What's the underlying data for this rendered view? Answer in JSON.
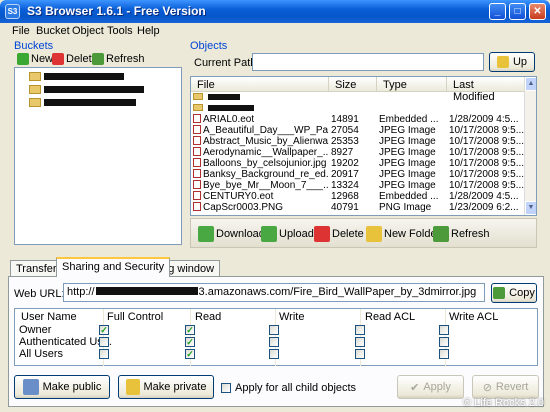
{
  "window": {
    "title": "S3 Browser 1.6.1 - Free Version",
    "app_icon_text": "S3"
  },
  "menu": [
    "File",
    "Bucket",
    "Object",
    "Tools",
    "Help"
  ],
  "buckets": {
    "label": "Buckets",
    "toolbar": {
      "new": "New",
      "delete": "Delete",
      "refresh": "Refresh"
    }
  },
  "objects": {
    "label": "Objects",
    "current_path_label": "Current Path:",
    "current_path_value": "",
    "up_label": "Up",
    "columns": [
      "File",
      "Size",
      "Type",
      "Last Modified"
    ],
    "rows": [
      {
        "name": "",
        "size": "",
        "type": "",
        "modified": "",
        "kind": "folder"
      },
      {
        "name": "",
        "size": "",
        "type": "",
        "modified": "",
        "kind": "folder"
      },
      {
        "name": "ARIAL0.eot",
        "size": "14891",
        "type": "Embedded ...",
        "modified": "1/28/2009 4:5...",
        "kind": "file"
      },
      {
        "name": "A_Beautiful_Day___WP_Pa...",
        "size": "27054",
        "type": "JPEG Image",
        "modified": "10/17/2008 9:5...",
        "kind": "file"
      },
      {
        "name": "Abstract_Music_by_Alienwa...",
        "size": "25353",
        "type": "JPEG Image",
        "modified": "10/17/2008 9:5...",
        "kind": "file"
      },
      {
        "name": "Aerodynamic__Wallpaper_...",
        "size": "8927",
        "type": "JPEG Image",
        "modified": "10/17/2008 9:5...",
        "kind": "file"
      },
      {
        "name": "Balloons_by_celsojunior.jpg",
        "size": "19202",
        "type": "JPEG Image",
        "modified": "10/17/2008 9:5...",
        "kind": "file"
      },
      {
        "name": "Banksy_Background_re_ed...",
        "size": "20917",
        "type": "JPEG Image",
        "modified": "10/17/2008 9:5...",
        "kind": "file"
      },
      {
        "name": "Bye_bye_Mr__Moon_7___...",
        "size": "13324",
        "type": "JPEG Image",
        "modified": "10/17/2008 9:5...",
        "kind": "file"
      },
      {
        "name": "CENTURY0.eot",
        "size": "12968",
        "type": "Embedded ...",
        "modified": "1/28/2009 4:5...",
        "kind": "file"
      },
      {
        "name": "CapScr0003.PNG",
        "size": "40791",
        "type": "PNG Image",
        "modified": "1/23/2009 6:2...",
        "kind": "file"
      }
    ],
    "toolbar": {
      "download": "Download",
      "upload": "Upload",
      "delete": "Delete",
      "new_folder": "New Folder",
      "refresh": "Refresh"
    }
  },
  "tabs": [
    "Transfers",
    "Sharing and Security",
    "Log window"
  ],
  "sharing": {
    "web_url_label": "Web URL:",
    "web_url_prefix": "http://",
    "web_url_suffix": "3.amazonaws.com/Fire_Bird_WallPaper_by_3dmirror.jpg",
    "copy_label": "Copy",
    "perm_columns": [
      "User Name",
      "Full Control",
      "Read",
      "Write",
      "Read ACL",
      "Write ACL"
    ],
    "perm_rows": [
      {
        "user": "Owner",
        "checks": [
          true,
          true,
          false,
          false,
          false
        ]
      },
      {
        "user": "Authenticated Us...",
        "checks": [
          false,
          true,
          false,
          false,
          false
        ]
      },
      {
        "user": "All Users",
        "checks": [
          false,
          true,
          false,
          false,
          false
        ]
      }
    ],
    "make_public": "Make public",
    "make_private": "Make private",
    "apply_children": "Apply for all child objects",
    "apply": "Apply",
    "revert": "Revert"
  },
  "watermark": "© Life Rocks 2.0"
}
